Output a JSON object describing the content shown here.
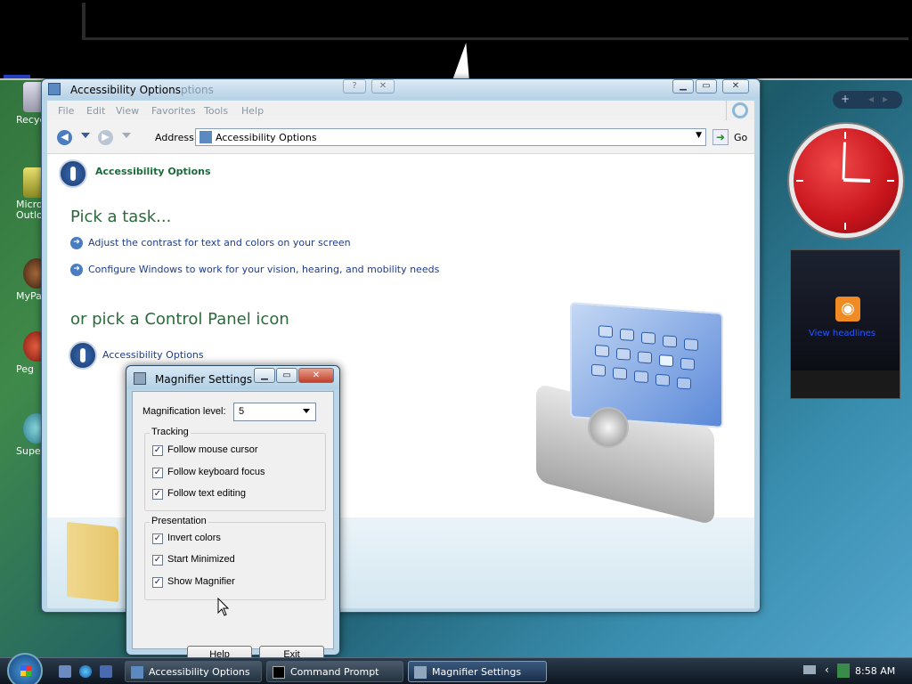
{
  "desktop": {
    "icons": [
      {
        "label": "Recyc"
      },
      {
        "label": "Micro Outlo"
      },
      {
        "label": "MyPa"
      },
      {
        "label": "Peg"
      },
      {
        "label": "Super"
      }
    ]
  },
  "sidebar": {
    "toolbar": {
      "add": "+",
      "prev": "◂",
      "next": "▸"
    },
    "feed": {
      "link": "View headlines"
    }
  },
  "explorer": {
    "title": "Accessibility Options",
    "title_ghost": "ptions",
    "menu": [
      "File",
      "Edit",
      "View",
      "Favorites",
      "Tools",
      "Help"
    ],
    "address_label": "Address",
    "address_value": "Accessibility Options",
    "go_label": "Go",
    "breadcrumb": "Accessibility Options",
    "pick_task": "Pick a task...",
    "tasks": [
      "Adjust the contrast for text and colors on your screen",
      "Configure Windows to work for your vision, hearing, and mobility needs"
    ],
    "pick_icon": "or pick a Control Panel icon",
    "cp_icon_label": "Accessibility Options"
  },
  "dialog": {
    "title": "Magnifier Settings",
    "mag_label": "Magnification level:",
    "mag_value": "5",
    "tracking": {
      "label": "Tracking",
      "items": [
        {
          "label": "Follow mouse cursor",
          "checked": true
        },
        {
          "label": "Follow keyboard focus",
          "checked": true
        },
        {
          "label": "Follow text editing",
          "checked": true
        }
      ]
    },
    "presentation": {
      "label": "Presentation",
      "items": [
        {
          "label": "Invert colors",
          "checked": true
        },
        {
          "label": "Start Minimized",
          "checked": true
        },
        {
          "label": "Show Magnifier",
          "checked": true
        }
      ]
    },
    "help_button": "Help",
    "exit_button": "Exit"
  },
  "taskbar": {
    "items": [
      {
        "label": "Accessibility Options",
        "active": false
      },
      {
        "label": "Command Prompt",
        "active": false
      },
      {
        "label": "Magnifier Settings",
        "active": true
      }
    ],
    "clock": "8:58 AM"
  },
  "colors": {
    "link": "#1e3c8a",
    "heading": "#2a6a3a",
    "accent": "#4a7cc0"
  }
}
